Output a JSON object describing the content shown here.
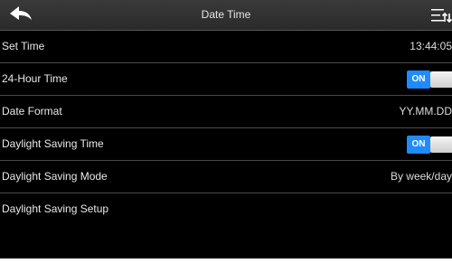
{
  "header": {
    "title": "Date Time",
    "back_icon": "back-arrow-icon",
    "menu_icon": "sort-menu-icon"
  },
  "rows": [
    {
      "label": "Set Time",
      "value": "13:44:05"
    },
    {
      "label": "24-Hour Time",
      "toggle": "ON"
    },
    {
      "label": "Date Format",
      "value": "YY.MM.DD"
    },
    {
      "label": "Daylight Saving Time",
      "toggle": "ON"
    },
    {
      "label": "Daylight Saving Mode",
      "value": "By week/day"
    },
    {
      "label": "Daylight Saving Setup"
    }
  ],
  "colors": {
    "background": "#000000",
    "header": "#333333",
    "toggle_on": "#1f8bff",
    "text": "#e8e8e8",
    "divider": "#4a4a4a"
  }
}
